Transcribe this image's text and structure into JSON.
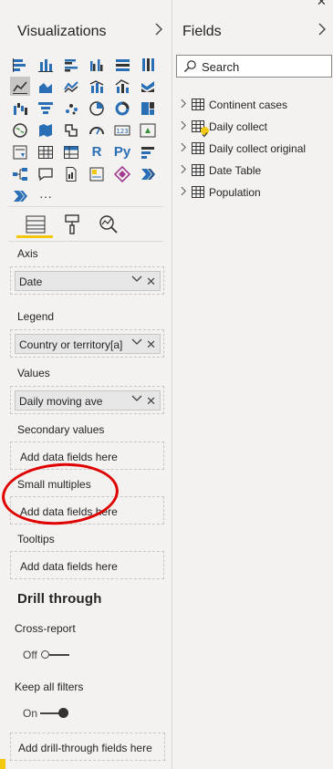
{
  "visualizations": {
    "title": "Visualizations",
    "icons": [
      "stacked-bar-icon",
      "stacked-column-icon",
      "clustered-bar-icon",
      "clustered-column-icon",
      "100-stacked-bar-icon",
      "100-stacked-column-icon",
      "line-chart-icon",
      "area-chart-icon",
      "stacked-area-icon",
      "line-clustered-column-icon",
      "line-stacked-column-icon",
      "ribbon-chart-icon",
      "waterfall-icon",
      "funnel-icon",
      "scatter-icon",
      "pie-icon",
      "donut-icon",
      "treemap-icon",
      "map-icon",
      "filled-map-icon",
      "shape-map-icon",
      "gauge-icon",
      "card-icon",
      "kpi-icon",
      "slicer-icon",
      "table-icon",
      "matrix-icon",
      "r-visual-icon",
      "python-visual-icon",
      "key-influencers-icon",
      "decomposition-tree-icon",
      "qa-icon",
      "paginated-report-icon",
      "smart-narrative-icon",
      "power-apps-icon",
      "power-automate-icon",
      "arcgis-icon",
      "more-visuals-icon"
    ],
    "icon_text": {
      "r": "R",
      "py": "Py",
      "card": "123",
      "more": "···"
    },
    "tabs": [
      "fields-tab-icon",
      "format-tab-icon",
      "analytics-tab-icon"
    ],
    "wells": {
      "axis": {
        "label": "Axis",
        "value": "Date"
      },
      "legend": {
        "label": "Legend",
        "value": "Country or territory[a]"
      },
      "values": {
        "label": "Values",
        "value": "Daily moving ave"
      },
      "secondary": {
        "label": "Secondary values",
        "placeholder": "Add data fields here"
      },
      "small_multiples": {
        "label": "Small multiples",
        "placeholder": "Add data fields here"
      },
      "tooltips": {
        "label": "Tooltips",
        "placeholder": "Add data fields here"
      }
    },
    "drill": {
      "title": "Drill through",
      "cross_report": {
        "label": "Cross-report",
        "state": "Off"
      },
      "keep_filters": {
        "label": "Keep all filters",
        "state": "On"
      },
      "placeholder": "Add drill-through fields here"
    }
  },
  "fields": {
    "title": "Fields",
    "search_placeholder": "Search",
    "tables": [
      {
        "label": "Continent cases"
      },
      {
        "label": "Daily collect"
      },
      {
        "label": "Daily collect original"
      },
      {
        "label": "Date Table"
      },
      {
        "label": "Population"
      }
    ]
  },
  "colors": {
    "accent": "#f2c811",
    "annotation": "#e00000",
    "icon_blue": "#2a6fb5"
  }
}
